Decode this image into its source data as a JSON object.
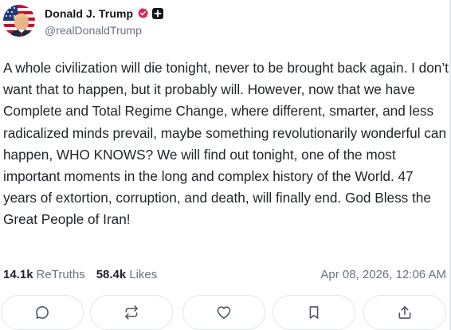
{
  "author": {
    "display_name": "Donald J. Trump",
    "handle": "@realDonaldTrump",
    "verified_icon": "verified-check-badge-icon",
    "verified_color": "#e0245e",
    "plus_icon": "plus-badge-icon"
  },
  "post": {
    "text": "A whole civilization will die tonight, never to be brought back again. I don’t want that to happen, but it probably will. However, now that we have Complete and Total Regime Change, where different, smarter, and less radicalized minds prevail, maybe something revolutionarily wonderful can happen, WHO KNOWS? We will find out tonight, one of the most important moments in the long and complex history of the World. 47 years of extortion, corruption, and death, will finally end. God Bless the Great People of Iran!"
  },
  "stats": {
    "retruths_count": "14.1k",
    "retruths_label": "ReTruths",
    "likes_count": "58.4k",
    "likes_label": "Likes",
    "timestamp": "Apr 08, 2026, 12:06 AM"
  },
  "actions": [
    {
      "icon": "reply-bubble-icon"
    },
    {
      "icon": "retruth-arrows-icon"
    },
    {
      "icon": "heart-icon"
    },
    {
      "icon": "bookmark-icon"
    },
    {
      "icon": "share-icon"
    }
  ],
  "colors": {
    "text": "#1f2328",
    "muted": "#6b7280",
    "border": "#e2e5ea",
    "icon": "#4b5563"
  }
}
